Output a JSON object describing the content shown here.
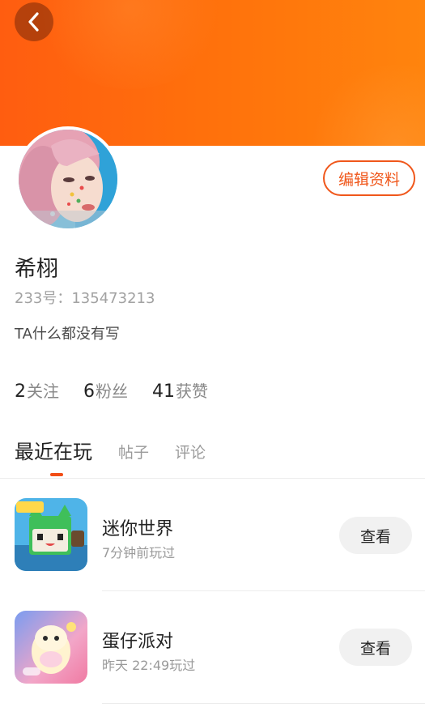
{
  "header": {
    "accent": "#ff6a10"
  },
  "profile": {
    "edit_label": "编辑资料",
    "name": "希栩",
    "uid": "233号：135473213",
    "bio": "TA什么都没有写"
  },
  "stats": [
    {
      "num": "2",
      "label": "关注"
    },
    {
      "num": "6",
      "label": "粉丝"
    },
    {
      "num": "41",
      "label": "获赞"
    }
  ],
  "tabs": [
    {
      "label": "最近在玩",
      "active": true
    },
    {
      "label": "帖子",
      "active": false
    },
    {
      "label": "评论",
      "active": false
    }
  ],
  "games": [
    {
      "name": "迷你世界",
      "time": "7分钟前玩过",
      "button": "查看",
      "icon": "mini-world-icon"
    },
    {
      "name": "蛋仔派对",
      "time": "昨天 22:49玩过",
      "button": "查看",
      "icon": "eggy-party-icon"
    }
  ]
}
